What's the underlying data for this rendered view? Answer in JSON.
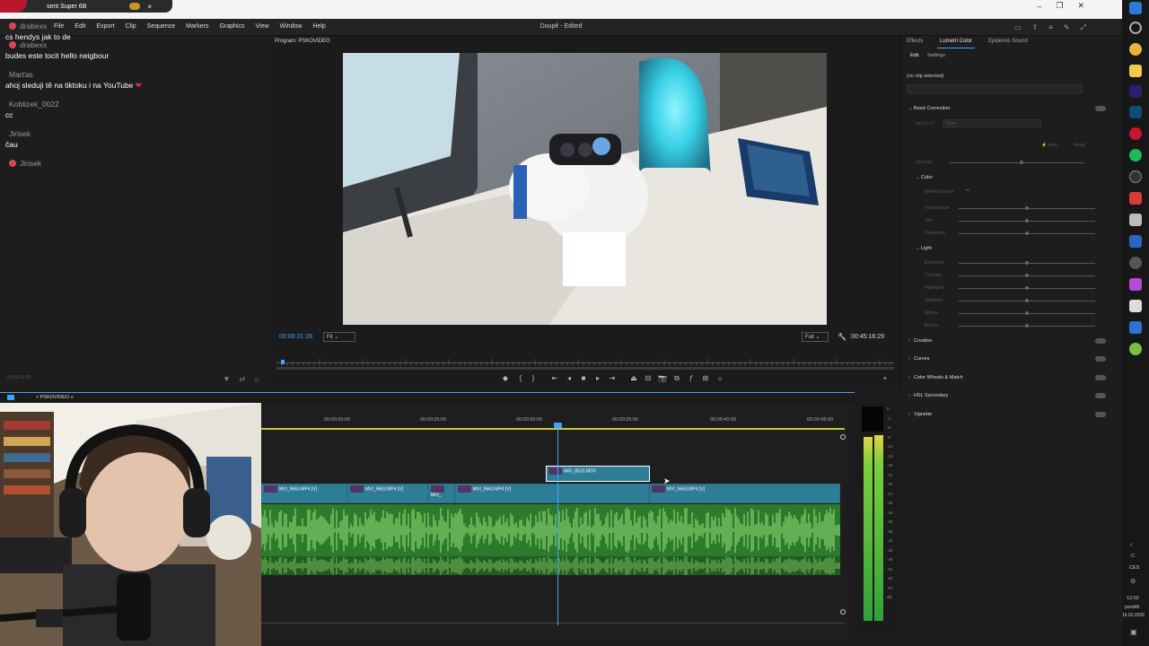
{
  "notification": {
    "text": "sent Super 6B",
    "close": "×"
  },
  "window_controls": {
    "minimize": "–",
    "restore": "❐",
    "close": "✕"
  },
  "menubar": {
    "menus": [
      "File",
      "Edit",
      "Export",
      "Clip",
      "Sequence",
      "Markers",
      "Graphics",
      "View",
      "Window",
      "Help"
    ],
    "title": "Doupě - Edited"
  },
  "chat": {
    "lines": [
      {
        "user": "drabexx",
        "text": "cs hendys jak to de"
      },
      {
        "user": "drabexx",
        "text": "budes este tocit hello neigbour"
      },
      {
        "user": "Marťas",
        "text": "ahoj sleduji tě na tiktoku i na YouTube ❤"
      },
      {
        "user": "Koblizek_0022",
        "text": "cc"
      },
      {
        "user": "Jirisek",
        "text": "čau"
      },
      {
        "user": "Jirisek",
        "text": ""
      }
    ],
    "footer_time": "00:00:31:28"
  },
  "program_monitor": {
    "header": "Program: PSKOVIDEO",
    "current_timecode": "00:00:31:28",
    "fit": "Fit",
    "resolution": "Full",
    "duration": "00:45:16:29"
  },
  "timeline": {
    "tab": "PSKOVIDEO",
    "ruler": [
      "00:00:20:00",
      "00:00:25:00",
      "00:00:30:00",
      "00:00:35:00",
      "00:00:40:00",
      "00:00:45:00"
    ],
    "clips_v1": [
      {
        "label": "MVI_9663.MP4 [V]"
      },
      {
        "label": "MVI_9663.MP4 [V]"
      },
      {
        "label": "MVI_"
      },
      {
        "label": "MVI_9663.MP4 [V]"
      },
      {
        "label": "MVI_9663.MP4 [V]"
      }
    ],
    "clip_v2": {
      "label": "IMG_8533.MOV"
    }
  },
  "meter": {
    "labels": [
      "0",
      "-3",
      "-6",
      "-9",
      "-12",
      "-15",
      "-18",
      "-21",
      "-24",
      "-27",
      "-30",
      "-33",
      "-36",
      "-39",
      "-42",
      "-45",
      "-48",
      "-51",
      "-54",
      "-57",
      "dB"
    ]
  },
  "lumetri": {
    "tabs": [
      "Effects",
      "Lumetri Color",
      "Epidemic Sound"
    ],
    "subtabs": [
      "Edit",
      "Settings"
    ],
    "clip": "(no clip selected)",
    "sections": [
      "Basic Correction",
      "Creative",
      "Curves",
      "Color Wheels & Match",
      "HSL Secondary",
      "Vignette"
    ],
    "input_lut": "Input LUT",
    "lut_value": "None",
    "auto": "Auto",
    "reset": "Reset",
    "intensity": "Intensity",
    "color_group": "Color",
    "white_balance": "White Balance",
    "color_rows": [
      "Temperature",
      "Tint",
      "Saturation"
    ],
    "light_group": "Light",
    "light_rows": [
      "Exposure",
      "Contrast",
      "Highlights",
      "Shadows",
      "Whites",
      "Blacks"
    ]
  },
  "taskbar": {
    "lang": "CES",
    "time": "12:02",
    "day": "pondělí",
    "date": "16.02.2026"
  }
}
